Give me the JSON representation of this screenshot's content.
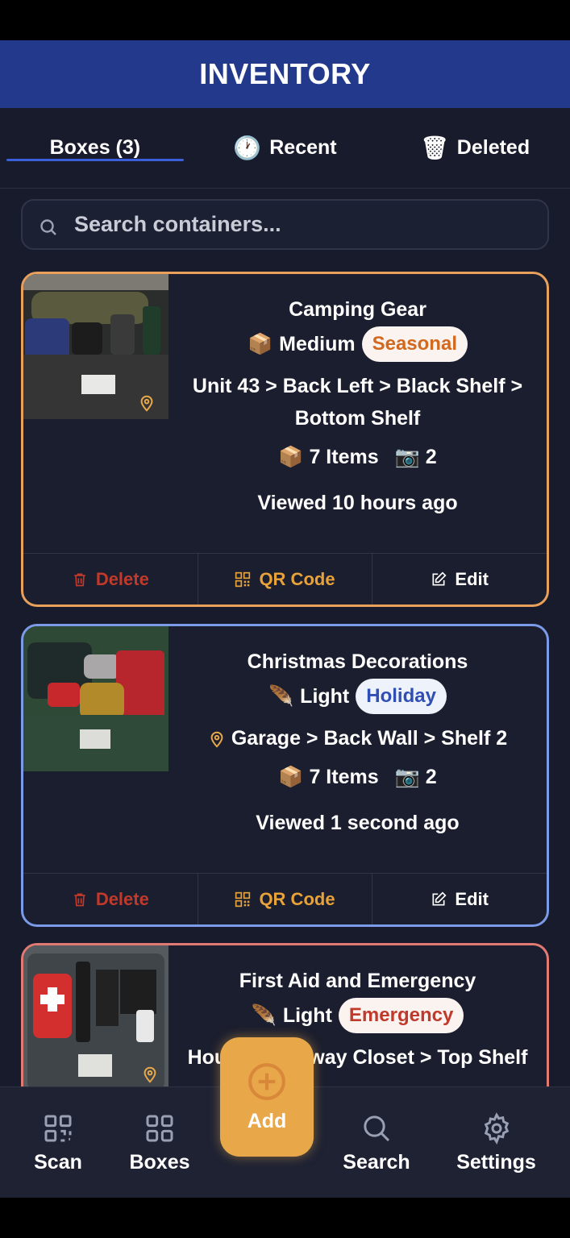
{
  "header": {
    "title": "INVENTORY"
  },
  "tabs": [
    {
      "label": "Boxes (3)",
      "icon": "",
      "active": true
    },
    {
      "label": "Recent",
      "icon": "🕐",
      "active": false
    },
    {
      "label": "Deleted",
      "icon": "🗑",
      "active": false
    }
  ],
  "search": {
    "placeholder": "Search containers..."
  },
  "cards": [
    {
      "title": "Camping Gear",
      "size_icon": "📦",
      "size": "Medium",
      "category": "Seasonal",
      "category_color": "#d2691e",
      "border_color": "#e8a05a",
      "location": "Unit 43 > Back Left > Black Shelf > Bottom Shelf",
      "items": "7 Items",
      "photos": "2",
      "viewed": "Viewed 10 hours ago"
    },
    {
      "title": "Christmas Decorations",
      "size_icon": "🪶",
      "size": "Light",
      "category": "Holiday",
      "category_color": "#2f4fb5",
      "border_color": "#7b9be8",
      "location": "Garage > Back Wall > Shelf 2",
      "items": "7 Items",
      "photos": "2",
      "viewed": "Viewed 1 second ago"
    },
    {
      "title": "First Aid and Emergency",
      "size_icon": "🪶",
      "size": "Light",
      "category": "Emergency",
      "category_color": "#c0392b",
      "border_color": "#e07a72",
      "location": "House > Hallway Closet > Top Shelf"
    }
  ],
  "actions": {
    "delete": "Delete",
    "qr": "QR Code",
    "edit": "Edit"
  },
  "nav": {
    "scan": "Scan",
    "boxes": "Boxes",
    "add": "Add",
    "search": "Search",
    "settings": "Settings"
  },
  "colors": {
    "header_bg": "#233a8c",
    "screen_bg": "#181b2b",
    "accent_orange": "#e8a84a",
    "delete_red": "#c0392b"
  }
}
